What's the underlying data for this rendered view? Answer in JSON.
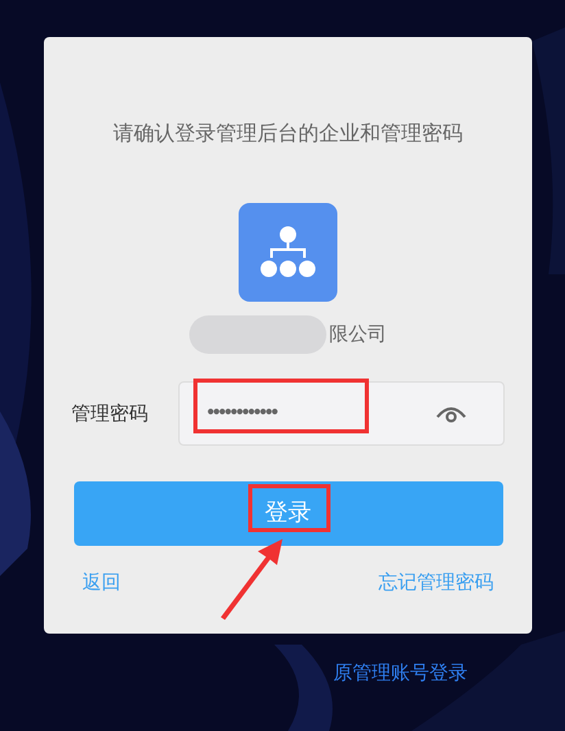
{
  "dialog": {
    "prompt": "请确认登录管理后台的企业和管理密码",
    "company": {
      "visible_part": "限公司"
    },
    "password": {
      "label": "管理密码",
      "value": "••••••••••••"
    },
    "login_button": "登录",
    "links": [
      {
        "label": "返回"
      },
      {
        "label": "忘记管理密码"
      }
    ]
  },
  "footer_link": "原管理账号登录"
}
